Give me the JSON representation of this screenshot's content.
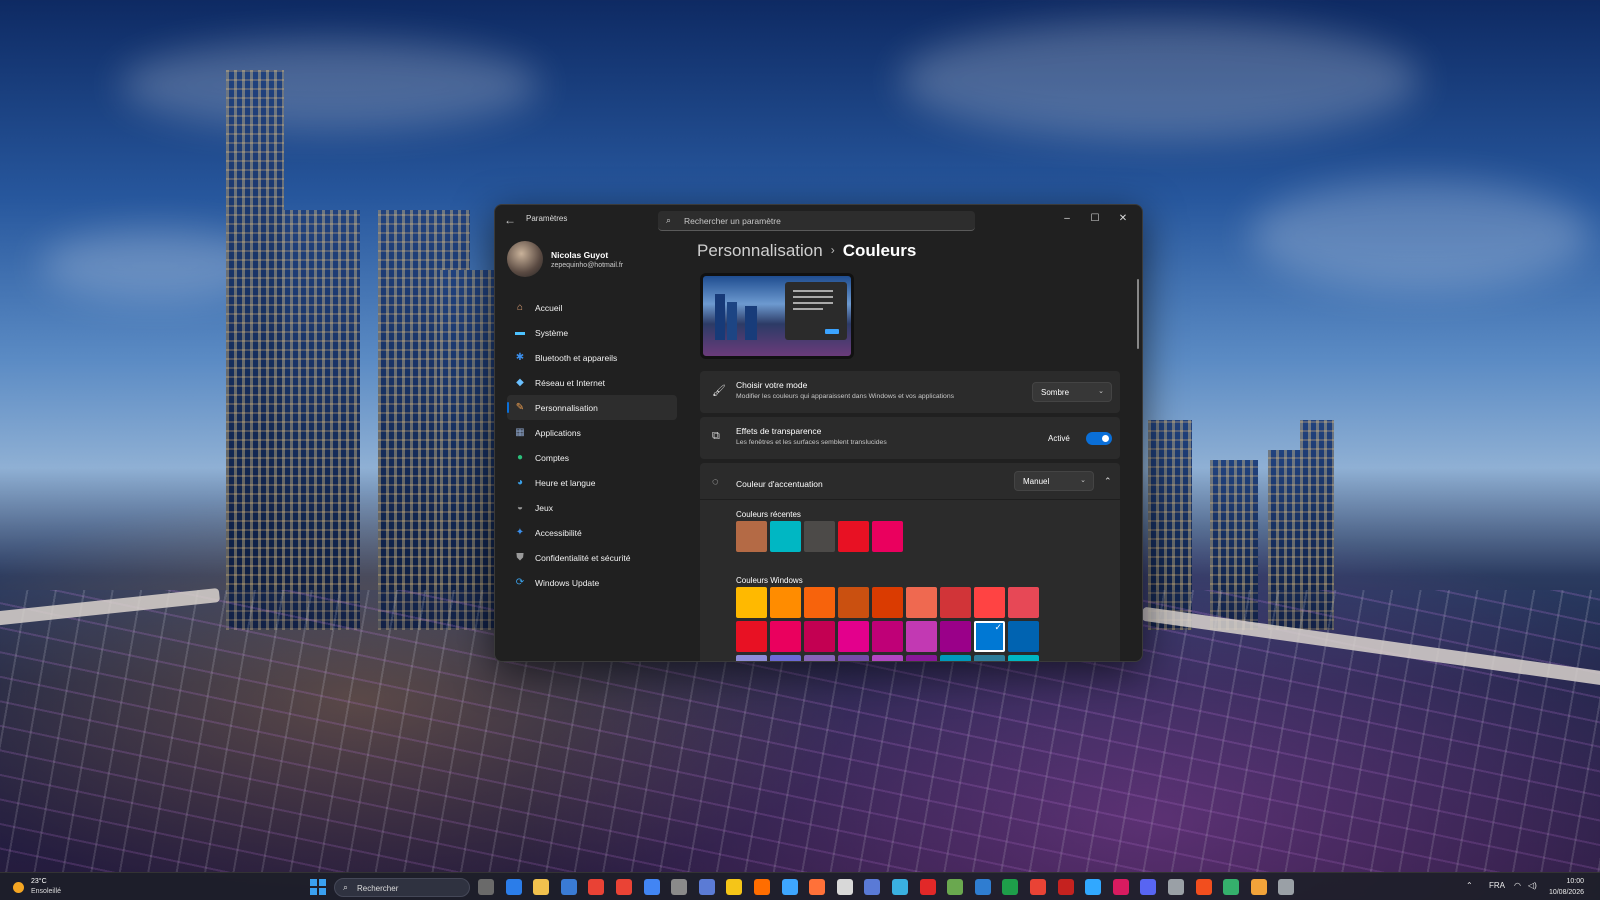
{
  "window": {
    "title": "Paramètres",
    "search_placeholder": "Rechercher un paramètre"
  },
  "user": {
    "name": "Nicolas Guyot",
    "email": "zepequinho@hotmail.fr"
  },
  "nav": [
    {
      "label": "Accueil",
      "icon": "home-icon",
      "color": "#e8a77a",
      "glyph": "⌂"
    },
    {
      "label": "Système",
      "icon": "monitor-icon",
      "color": "#4cc2ff",
      "glyph": "▬"
    },
    {
      "label": "Bluetooth et appareils",
      "icon": "bluetooth-icon",
      "color": "#3b8eea",
      "glyph": "✱"
    },
    {
      "label": "Réseau et Internet",
      "icon": "wifi-icon",
      "color": "#6ac0ff",
      "glyph": "◆"
    },
    {
      "label": "Personnalisation",
      "icon": "brush-icon",
      "color": "#f0a050",
      "glyph": "✎",
      "active": true
    },
    {
      "label": "Applications",
      "icon": "apps-icon",
      "color": "#8aa2c8",
      "glyph": "▦"
    },
    {
      "label": "Comptes",
      "icon": "person-icon",
      "color": "#2bbf7a",
      "glyph": "●"
    },
    {
      "label": "Heure et langue",
      "icon": "globe-clock-icon",
      "color": "#3aa0e8",
      "glyph": "◕"
    },
    {
      "label": "Jeux",
      "icon": "gamepad-icon",
      "color": "#9a9a9a",
      "glyph": "◒"
    },
    {
      "label": "Accessibilité",
      "icon": "accessibility-icon",
      "color": "#3b8eea",
      "glyph": "✦"
    },
    {
      "label": "Confidentialité et sécurité",
      "icon": "shield-icon",
      "color": "#9a9a9a",
      "glyph": "⛊"
    },
    {
      "label": "Windows Update",
      "icon": "update-icon",
      "color": "#3aa0e8",
      "glyph": "⟳"
    }
  ],
  "breadcrumb": {
    "parent": "Personnalisation",
    "separator": "›",
    "current": "Couleurs"
  },
  "mode": {
    "title": "Choisir votre mode",
    "subtitle": "Modifier les couleurs qui apparaissent dans Windows et vos applications",
    "value": "Sombre"
  },
  "transparency": {
    "title": "Effets de transparence",
    "subtitle": "Les fenêtres et les surfaces semblent translucides",
    "state": "Activé",
    "on": true
  },
  "accent": {
    "title": "Couleur d'accentuation",
    "value": "Manuel",
    "recent_label": "Couleurs récentes",
    "recent": [
      "#b46a45",
      "#00b7c3",
      "#4c4a48",
      "#e81123",
      "#ea005e"
    ],
    "windows_label": "Couleurs Windows",
    "windows_row1": [
      "#ffb900",
      "#ff8c00",
      "#f7630c",
      "#ca5010",
      "#da3b01",
      "#ef6950",
      "#d13438",
      "#ff4343",
      "#e74856"
    ],
    "windows_row2": [
      "#e81123",
      "#ea005e",
      "#c30052",
      "#e3008c",
      "#bf0077",
      "#c239b3",
      "#9a0089",
      "#0078d4",
      "#0063b1"
    ],
    "selected_index_row2": 7
  },
  "taskbar": {
    "temperature": "23°C",
    "weather": "Ensoleillé",
    "search": "Rechercher",
    "language": "FRA",
    "time": "10:00",
    "date": "10/08/2026"
  }
}
